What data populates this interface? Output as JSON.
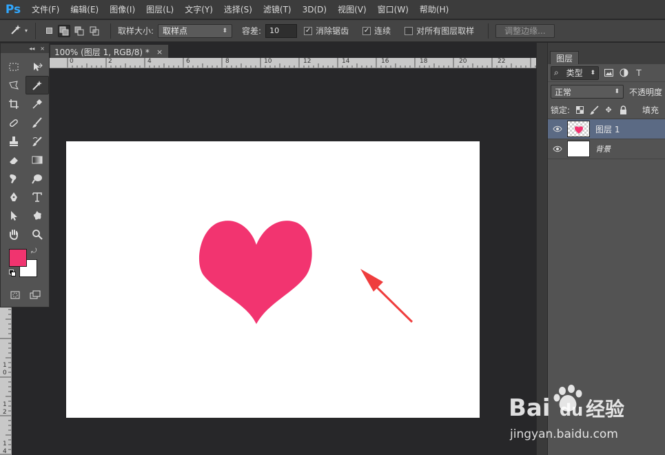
{
  "app": {
    "logo": "Ps"
  },
  "menu": [
    "文件(F)",
    "编辑(E)",
    "图像(I)",
    "图层(L)",
    "文字(Y)",
    "选择(S)",
    "滤镜(T)",
    "3D(D)",
    "视图(V)",
    "窗口(W)",
    "帮助(H)"
  ],
  "options": {
    "sample_size_label": "取样大小:",
    "sample_size_value": "取样点",
    "tolerance_label": "容差:",
    "tolerance_value": "10",
    "anti_alias_label": "消除锯齿",
    "anti_alias_checked": true,
    "contiguous_label": "连续",
    "contiguous_checked": true,
    "sample_all_label": "对所有图层取样",
    "sample_all_checked": false,
    "refine_edge_label": "调整边缘..."
  },
  "document": {
    "tab_title": "100% (图层 1, RGB/8) *",
    "close_glyph": "×",
    "h_ruler": [
      "0",
      "2",
      "4",
      "6",
      "8",
      "10",
      "12",
      "14",
      "16",
      "18",
      "20",
      "22"
    ],
    "v_ruler": [
      "1",
      "0",
      "1",
      "2",
      "1",
      "4"
    ]
  },
  "tools": {
    "panel_controls": [
      "◂◂",
      "×"
    ],
    "foreground_color": "#f0346f",
    "background_color": "#ffffff"
  },
  "canvas": {
    "heart_color": "#f23470",
    "arrow_color": "#ef3d3d"
  },
  "layers_panel": {
    "tab_label": "图层",
    "filter_label": "类型",
    "blend_mode": "正常",
    "opacity_label": "不透明度",
    "lock_label": "锁定:",
    "fill_label": "填充",
    "layers": [
      {
        "name": "图层 1",
        "selected": true
      },
      {
        "name": "背景",
        "selected": false
      }
    ]
  },
  "watermark": {
    "brand": "Bai",
    "brand2": "du",
    "suffix": "经验",
    "url": "jingyan.baidu.com"
  }
}
